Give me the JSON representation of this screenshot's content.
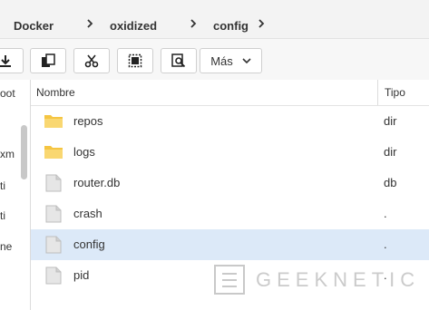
{
  "breadcrumb": {
    "items": [
      "Docker",
      "oxidized",
      "config"
    ]
  },
  "toolbar": {
    "buttons": [
      "download-icon",
      "copy-icon",
      "cut-icon",
      "select-icon",
      "search-icon"
    ],
    "more_label": "Más"
  },
  "left_panel": {
    "items": [
      "oot",
      "xm",
      "ti",
      "ti",
      "ne"
    ]
  },
  "file_list": {
    "columns": {
      "name": "Nombre",
      "type": "Tipo"
    },
    "rows": [
      {
        "name": "repos",
        "type": "dir",
        "icon": "folder-icon"
      },
      {
        "name": "logs",
        "type": "dir",
        "icon": "folder-icon"
      },
      {
        "name": "router.db",
        "type": "db",
        "icon": "file-icon"
      },
      {
        "name": "crash",
        "type": ".",
        "icon": "file-icon"
      },
      {
        "name": "config",
        "type": ".",
        "icon": "file-icon",
        "selected": true
      },
      {
        "name": "pid",
        "type": ".",
        "icon": "file-icon"
      }
    ]
  },
  "watermark": {
    "text": "GEEKNETIC"
  },
  "colors": {
    "selected_row": "#dce9f8",
    "folder": "#f5c542",
    "file": "#e6e6e6"
  }
}
